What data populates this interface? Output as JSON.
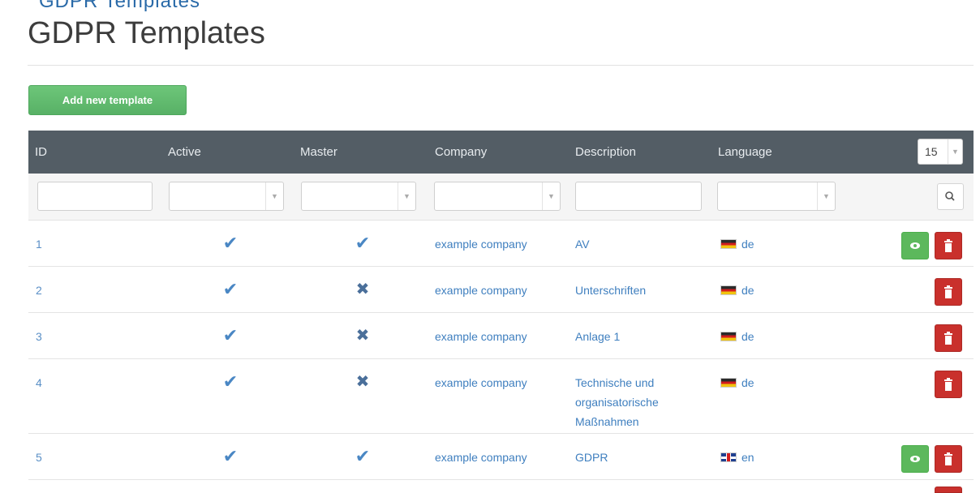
{
  "page": {
    "breadcrumb_partial": "GDPR Templates",
    "title": "GDPR Templates",
    "add_button_label": "Add new template",
    "per_page_value": "15"
  },
  "table": {
    "headers": [
      "ID",
      "Active",
      "Master",
      "Company",
      "Description",
      "Language"
    ],
    "rows": [
      {
        "id": "1",
        "active": true,
        "master": true,
        "company": "example company",
        "description": "AV",
        "language": "de",
        "has_view": true
      },
      {
        "id": "2",
        "active": true,
        "master": false,
        "company": "example company",
        "description": "Unterschriften",
        "language": "de",
        "has_view": false
      },
      {
        "id": "3",
        "active": true,
        "master": false,
        "company": "example company",
        "description": "Anlage 1",
        "language": "de",
        "has_view": false
      },
      {
        "id": "4",
        "active": true,
        "master": false,
        "company": "example company",
        "description": "Technische und organisatorische Maßnahmen",
        "language": "de",
        "has_view": false
      },
      {
        "id": "5",
        "active": true,
        "master": true,
        "company": "example company",
        "description": "GDPR",
        "language": "en",
        "has_view": true
      }
    ]
  },
  "icons": {
    "check": "checkmark-icon",
    "cross": "cross-icon",
    "view": "eye-icon",
    "delete": "trash-icon",
    "search": "search-icon"
  },
  "colors": {
    "header_bg": "#535d65",
    "add_button": "#5cb85c",
    "view_button": "#5cb85c",
    "delete_button": "#c9302c",
    "link": "#3f7fbf"
  }
}
